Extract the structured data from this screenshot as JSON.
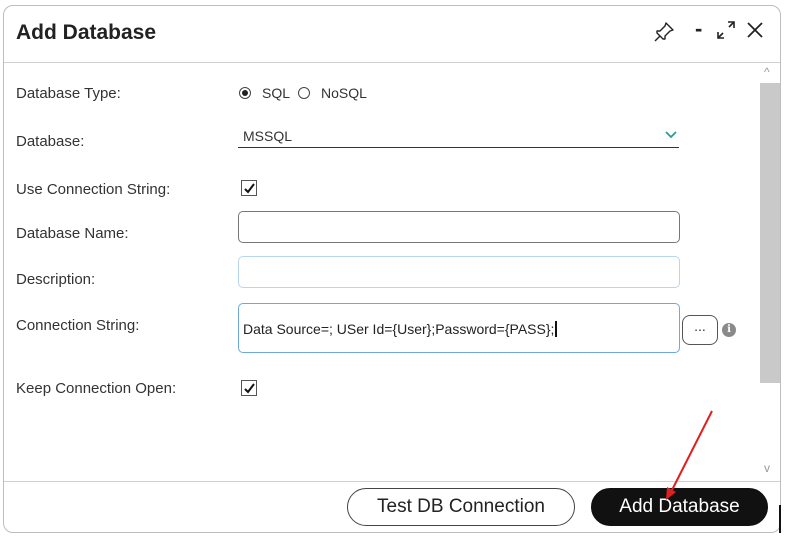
{
  "dialog": {
    "title": "Add Database",
    "icons": {
      "pin": "pin-icon",
      "minimize": "minimize-icon",
      "expand": "expand-icon",
      "close": "close-icon"
    }
  },
  "form": {
    "database_type": {
      "label": "Database Type:",
      "options": [
        {
          "label": "SQL",
          "selected": true
        },
        {
          "label": "NoSQL",
          "selected": false
        }
      ]
    },
    "database": {
      "label": "Database:",
      "value": "MSSQL"
    },
    "use_connection_string": {
      "label": "Use Connection String:",
      "checked": true
    },
    "database_name": {
      "label": "Database Name:",
      "value": ""
    },
    "description": {
      "label": "Description:",
      "value": ""
    },
    "connection_string": {
      "label": "Connection String:",
      "value": "Data Source=; USer Id={User};Password={PASS};",
      "browse_label": "...",
      "info_icon": "info-icon"
    },
    "keep_connection_open": {
      "label": "Keep Connection Open:",
      "checked": true
    }
  },
  "footer": {
    "test_button": "Test DB Connection",
    "add_button": "Add Database"
  },
  "colors": {
    "accent_border": "#6fa8dc",
    "primary_button": "#111111",
    "annotation_arrow": "#e02020"
  }
}
